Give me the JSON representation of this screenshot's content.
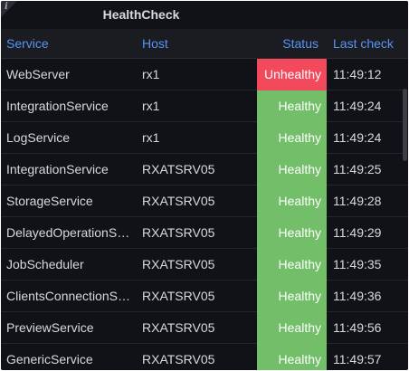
{
  "panel": {
    "title": "HealthCheck",
    "info_icon": "info-icon"
  },
  "table": {
    "columns": {
      "service": "Service",
      "host": "Host",
      "status": "Status",
      "last_check": "Last check"
    },
    "status_colors": {
      "Healthy": "#73bf69",
      "Unhealthy": "#f2495c"
    },
    "rows": [
      {
        "service": "WebServer",
        "host": "rx1",
        "status": "Unhealthy",
        "last_check": "11:49:12"
      },
      {
        "service": "IntegrationService",
        "host": "rx1",
        "status": "Healthy",
        "last_check": "11:49:24"
      },
      {
        "service": "LogService",
        "host": "rx1",
        "status": "Healthy",
        "last_check": "11:49:24"
      },
      {
        "service": "IntegrationService",
        "host": "RXATSRV05",
        "status": "Healthy",
        "last_check": "11:49:25"
      },
      {
        "service": "StorageService",
        "host": "RXATSRV05",
        "status": "Healthy",
        "last_check": "11:49:28"
      },
      {
        "service": "DelayedOperationService",
        "host": "RXATSRV05",
        "status": "Healthy",
        "last_check": "11:49:29"
      },
      {
        "service": "JobScheduler",
        "host": "RXATSRV05",
        "status": "Healthy",
        "last_check": "11:49:35"
      },
      {
        "service": "ClientsConnectionService",
        "host": "RXATSRV05",
        "status": "Healthy",
        "last_check": "11:49:36"
      },
      {
        "service": "PreviewService",
        "host": "RXATSRV05",
        "status": "Healthy",
        "last_check": "11:49:56"
      },
      {
        "service": "GenericService",
        "host": "RXATSRV05",
        "status": "Healthy",
        "last_check": "11:49:57"
      }
    ]
  }
}
